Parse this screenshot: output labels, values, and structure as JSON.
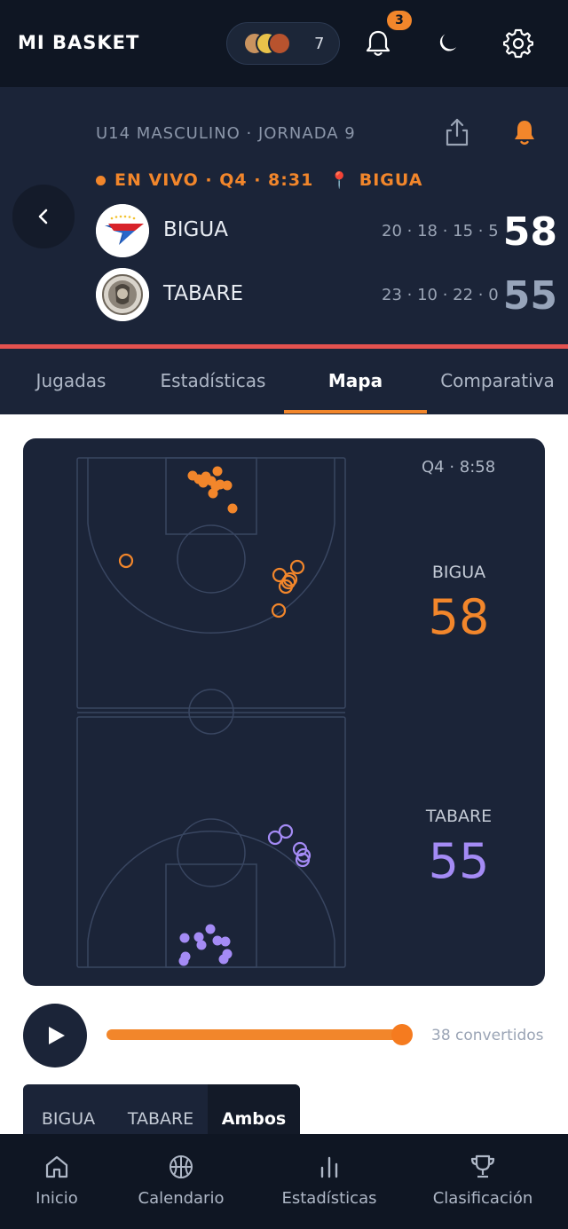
{
  "app": {
    "title": "MI BASKET"
  },
  "header": {
    "viewers_count": "7",
    "notifications_count": "3"
  },
  "game": {
    "league_round": "U14 MASCULINO · JORNADA 9",
    "status": "EN VIVO · Q4 · 8:31",
    "venue": "BIGUA",
    "teams": [
      {
        "name": "BIGUA",
        "quarters": "20 · 18 · 15 · 5",
        "score": "58"
      },
      {
        "name": "TABARE",
        "quarters": "23 · 10 · 22 · 0",
        "score": "55"
      }
    ]
  },
  "tabs": [
    "Jugadas",
    "Estadísticas",
    "Mapa",
    "Comparativa"
  ],
  "active_tab": "Mapa",
  "map": {
    "clock": "Q4 · 8:58",
    "home": {
      "name": "BIGUA",
      "score": "58",
      "color": "#f2862b"
    },
    "away": {
      "name": "TABARE",
      "score": "55",
      "color": "#a48bf5"
    }
  },
  "player": {
    "made_label": "38 convertidos",
    "progress": 1.0
  },
  "team_filter": {
    "options": [
      "BIGUA",
      "TABARE",
      "Ambos"
    ],
    "selected": "Ambos"
  },
  "bottom_nav": [
    "Inicio",
    "Calendario",
    "Estadísticas",
    "Clasificación"
  ],
  "colors": {
    "accent": "#f2862b",
    "live_bar": "#e4524f",
    "dark_bg": "#0f1623",
    "panel_bg": "#1b2438"
  }
}
